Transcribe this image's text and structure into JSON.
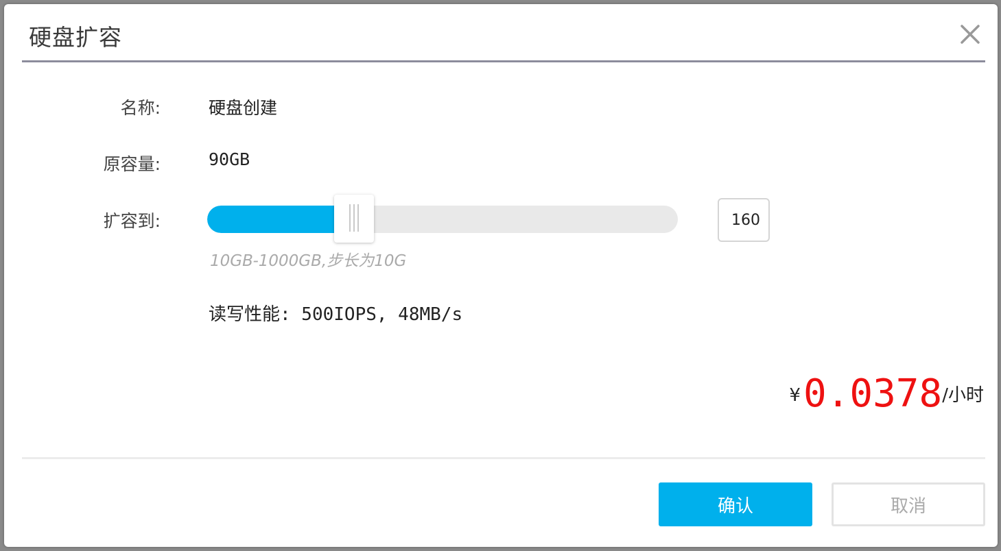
{
  "dialog": {
    "title": "硬盘扩容",
    "close_icon": "close-icon"
  },
  "form": {
    "name_label": "名称:",
    "name_value": "硬盘创建",
    "original_capacity_label": "原容量:",
    "original_capacity_value": "90GB",
    "expand_to_label": "扩容到:",
    "slider": {
      "min": 10,
      "max": 1000,
      "value": 160,
      "hint": "10GB-1000GB,步长为10G"
    },
    "stepper_value": "160",
    "performance": "读写性能: 500IOPS, 48MB/s"
  },
  "price": {
    "currency": "¥",
    "amount": "0.0378",
    "unit": "/小时"
  },
  "colors": {
    "accent": "#00b0ec",
    "price": "#ee1111"
  },
  "buttons": {
    "confirm_label": "确认",
    "cancel_label": "取消"
  }
}
